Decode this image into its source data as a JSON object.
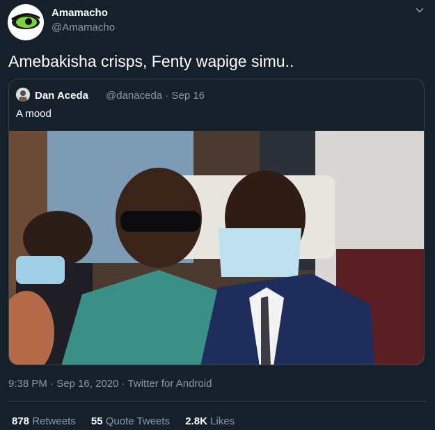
{
  "author": {
    "name": "Amamacho",
    "handle": "@Amamacho"
  },
  "tweet": {
    "text": "Amebakisha crisps, Fenty wapige simu.."
  },
  "quoted": {
    "name": "Dan Aceda",
    "handle": "@danaceda",
    "separator": "·",
    "date": "Sep 16",
    "text": "A mood"
  },
  "meta": {
    "time": "9:38 PM",
    "separator": "·",
    "date": "Sep 16, 2020",
    "separator2": "·",
    "source": "Twitter for Android"
  },
  "stats": {
    "retweets": {
      "count": "878",
      "label": "Retweets"
    },
    "quotes": {
      "count": "55",
      "label": "Quote Tweets"
    },
    "likes": {
      "count": "2.8K",
      "label": "Likes"
    }
  },
  "colors": {
    "background": "#15202b",
    "secondary_text": "#8899a6",
    "border": "#38444d"
  },
  "icons": {
    "menu": "chevron-down-icon"
  }
}
